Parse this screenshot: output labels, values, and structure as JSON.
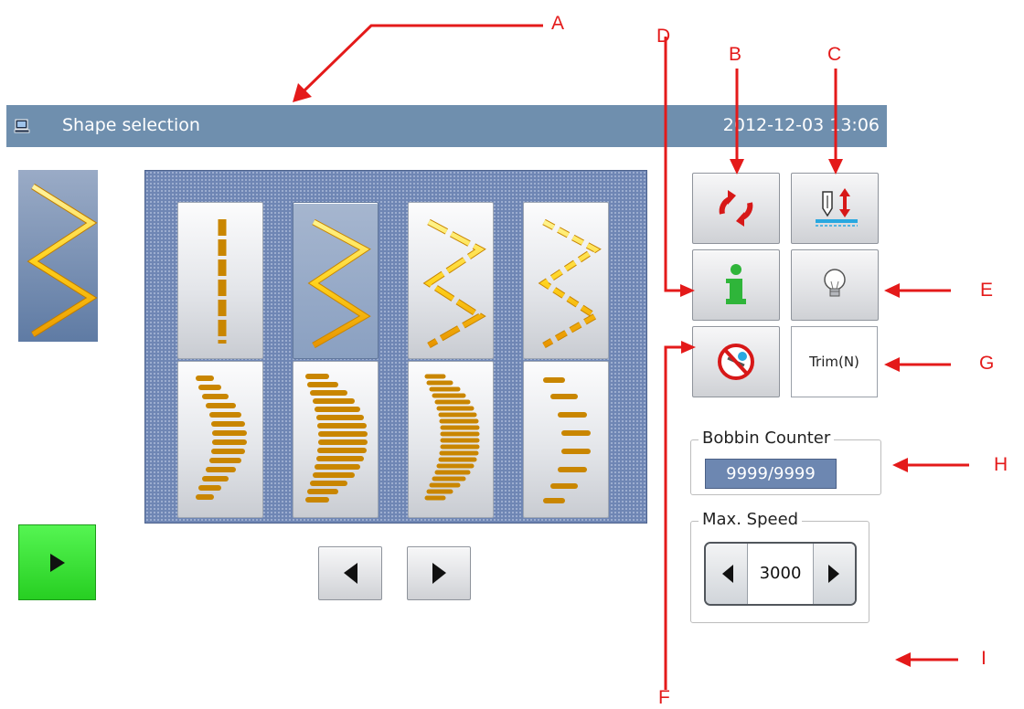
{
  "titlebar": {
    "title": "Shape selection",
    "datetime": "2012-12-03  13:06",
    "icon": "computer-icon"
  },
  "shapes": [
    {
      "name": "straight-dashed",
      "selected": false
    },
    {
      "name": "zigzag",
      "selected": true
    },
    {
      "name": "zigzag-dashed",
      "selected": false
    },
    {
      "name": "zigzag-dotted",
      "selected": false
    },
    {
      "name": "crescent-narrow",
      "selected": false
    },
    {
      "name": "crescent-wide",
      "selected": false
    },
    {
      "name": "crescent-dense",
      "selected": false
    },
    {
      "name": "crescent-sparse",
      "selected": false
    }
  ],
  "buttons": {
    "reset_icon": "cycle-arrows-icon",
    "presser_icon": "needle-up-down-icon",
    "info_icon": "info-icon",
    "light_icon": "light-bulb-icon",
    "no_trim_icon": "no-trim-icon",
    "trim_label": "Trim(N)",
    "start_icon": "play-icon"
  },
  "bobbin_counter": {
    "label": "Bobbin Counter",
    "value": "9999/9999"
  },
  "max_speed": {
    "label": "Max. Speed",
    "value": "3000"
  },
  "callouts": [
    "A",
    "B",
    "C",
    "D",
    "E",
    "F",
    "G",
    "H",
    "I"
  ],
  "colors": {
    "titlebar": "#6f8fae",
    "grid_panel": "#6f86b4",
    "start_button": "#2dd428",
    "stitch": "#ffd21c",
    "annotation": "#e41a1a"
  }
}
